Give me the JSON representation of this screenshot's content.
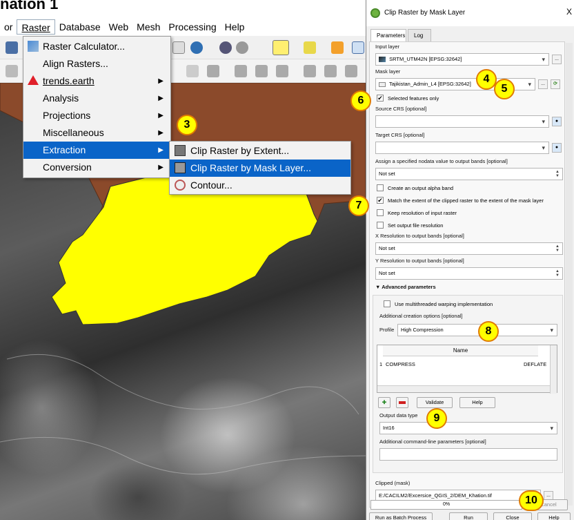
{
  "caption": "nation 1",
  "menubar": {
    "items": [
      {
        "label": "or"
      },
      {
        "label": "Raster"
      },
      {
        "label": "Database"
      },
      {
        "label": "Web"
      },
      {
        "label": "Mesh"
      },
      {
        "label": "Processing"
      },
      {
        "label": "Help"
      }
    ]
  },
  "raster_menu": {
    "items": [
      {
        "label": "Raster Calculator...",
        "icon": "raster-calculator-icon"
      },
      {
        "label": "Align Rasters..."
      },
      {
        "label": "trends.earth",
        "icon": "trends-earth-icon"
      },
      {
        "label": "Analysis"
      },
      {
        "label": "Projections"
      },
      {
        "label": "Miscellaneous"
      },
      {
        "label": "Extraction"
      },
      {
        "label": "Conversion"
      }
    ]
  },
  "extraction_submenu": {
    "items": [
      {
        "label": "Clip Raster by Extent..."
      },
      {
        "label": "Clip Raster by Mask Layer..."
      },
      {
        "label": "Contour..."
      }
    ]
  },
  "callouts": {
    "c3": "3",
    "c4": "4",
    "c5": "5",
    "c6": "6",
    "c7": "7",
    "c8": "8",
    "c9": "9",
    "c10": "10"
  },
  "dialog": {
    "title": "Clip Raster by Mask Layer",
    "close": "X",
    "tabs": {
      "parameters": "Parameters",
      "log": "Log"
    },
    "input_layer_label": "Input layer",
    "input_layer_value": "SRTM_UTM42N [EPSG:32642]",
    "mask_layer_label": "Mask layer",
    "mask_layer_value": "Tajikistan_Admin_L4 [EPSG:32642]",
    "selected_only": "Selected features only",
    "source_crs_label": "Source CRS [optional]",
    "target_crs_label": "Target CRS [optional]",
    "nodata_label": "Assign a specified nodata value to output bands [optional]",
    "nodata_value": "Not set",
    "alpha_band": "Create an output alpha band",
    "match_extent": "Match the extent of the clipped raster to the extent of the mask layer",
    "keep_resolution": "Keep resolution of input raster",
    "set_resolution": "Set output file resolution",
    "x_res_label": "X Resolution to output bands [optional]",
    "x_res_value": "Not set",
    "y_res_label": "Y Resolution to output bands [optional]",
    "y_res_value": "Not set",
    "advanced_label": "Advanced parameters",
    "multithread": "Use multithreaded warping implementation",
    "creation_options_label": "Additional creation options [optional]",
    "profile_label": "Profile",
    "profile_value": "High Compression",
    "table_header": "Name",
    "table_row_index": "1",
    "table_row_name": "COMPRESS",
    "table_row_value": "DEFLATE",
    "validate": "Validate",
    "help_small": "Help",
    "output_type_label": "Output data type",
    "output_type_value": "Int16",
    "cmdline_label": "Additional command-line parameters [optional]",
    "clipped_label": "Clipped (mask)",
    "clipped_value": "E:/CACILM2/Excersice_QGIS_2/DEM_Khation.tif",
    "browse": "...",
    "progress": "0%",
    "cancel": "Cancel",
    "batch": "Run as Batch Process",
    "run": "Run",
    "close_btn": "Close",
    "help": "Help"
  },
  "colors": {
    "menu_selected": "#0a64c8",
    "mask_fill": "#ffff00",
    "region_fill": "#8b4a2b",
    "callout_fill": "#ffff00",
    "callout_border": "#e07b00"
  }
}
